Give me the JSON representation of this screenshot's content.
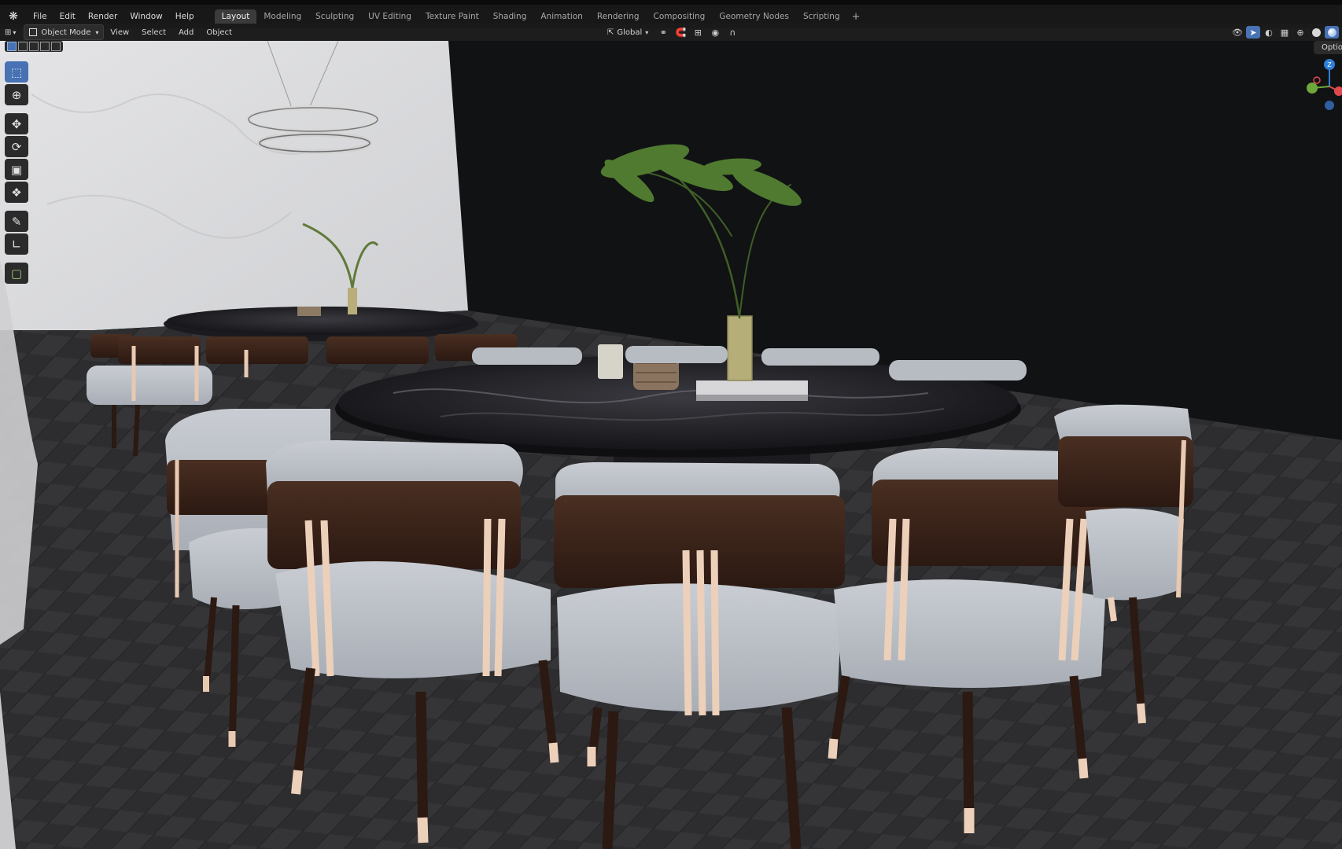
{
  "topbar": {
    "logo_icon": "blender-logo-icon",
    "menus": [
      "File",
      "Edit",
      "Render",
      "Window",
      "Help"
    ],
    "workspaces": [
      "Layout",
      "Modeling",
      "Sculpting",
      "UV Editing",
      "Texture Paint",
      "Shading",
      "Animation",
      "Rendering",
      "Compositing",
      "Geometry Nodes",
      "Scripting"
    ],
    "active_workspace": "Layout",
    "add_workspace": "+"
  },
  "viewport_header": {
    "mode": "Object Mode",
    "menus": [
      "View",
      "Select",
      "Add",
      "Object"
    ],
    "transform_orientation": "Global",
    "options_label": "Optio"
  },
  "toolbar": {
    "tools": [
      "select-box-icon",
      "cursor-icon",
      "move-icon",
      "rotate-icon",
      "scale-icon",
      "transform-icon",
      "annotate-icon",
      "measure-icon",
      "add-cube-icon"
    ],
    "active_tool": "select-box-icon"
  },
  "gizmo": {
    "axes": [
      "Z",
      "Y",
      "X"
    ]
  },
  "colors": {
    "accent": "#4772b3",
    "axis_x": "#e0484f",
    "axis_y": "#6fa83a",
    "axis_z": "#2f7fd8"
  }
}
